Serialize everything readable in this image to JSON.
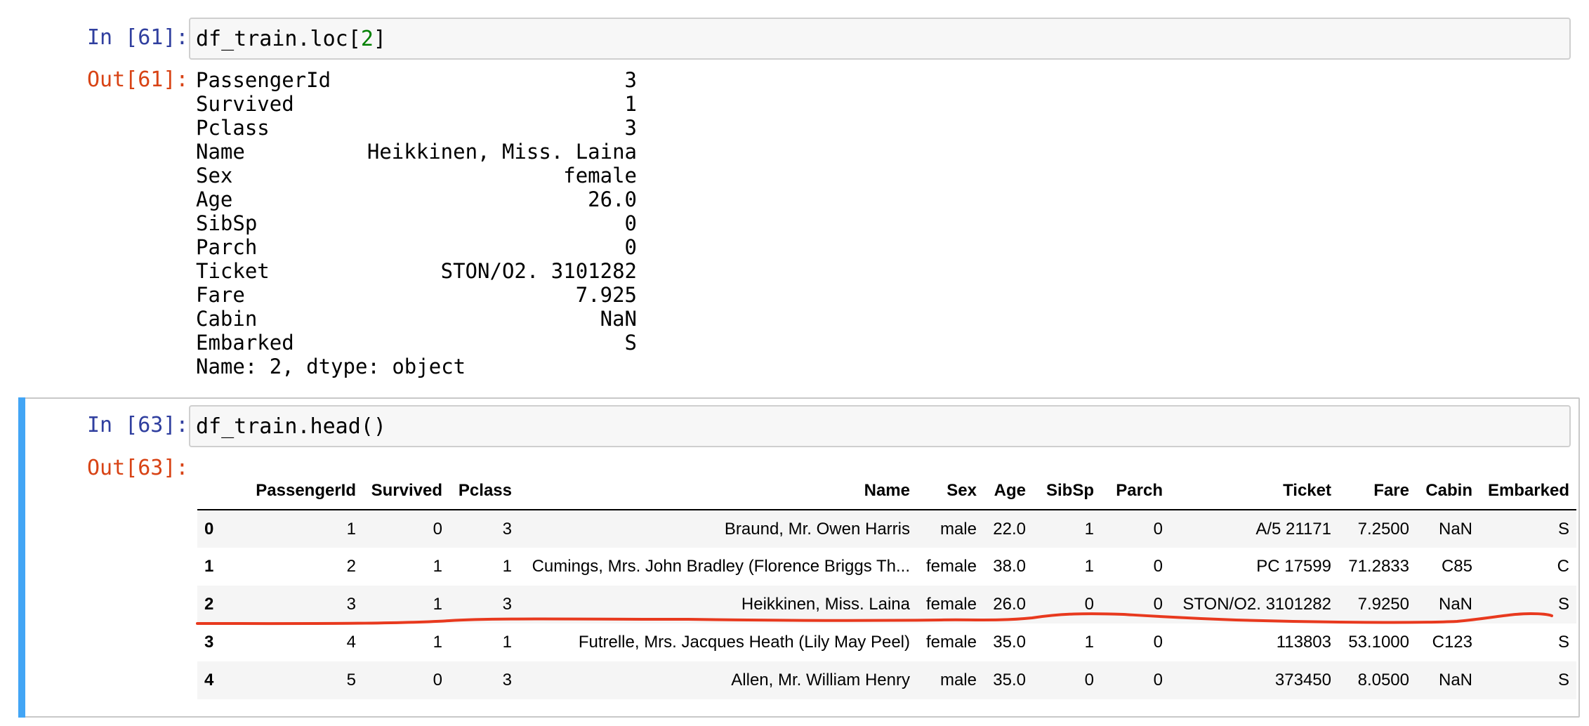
{
  "cell61": {
    "in_prompt": "In [61]:",
    "code_prefix": "df_train.loc[",
    "code_number": "2",
    "code_suffix": "]",
    "out_prompt": "Out[61]:",
    "series": [
      {
        "key": "PassengerId",
        "value": "3"
      },
      {
        "key": "Survived",
        "value": "1"
      },
      {
        "key": "Pclass",
        "value": "3"
      },
      {
        "key": "Name",
        "value": "Heikkinen, Miss. Laina"
      },
      {
        "key": "Sex",
        "value": "female"
      },
      {
        "key": "Age",
        "value": "26.0"
      },
      {
        "key": "SibSp",
        "value": "0"
      },
      {
        "key": "Parch",
        "value": "0"
      },
      {
        "key": "Ticket",
        "value": "STON/O2. 3101282"
      },
      {
        "key": "Fare",
        "value": "7.925"
      },
      {
        "key": "Cabin",
        "value": "NaN"
      },
      {
        "key": "Embarked",
        "value": "S"
      }
    ],
    "footer": "Name: 2, dtype: object"
  },
  "cell63": {
    "in_prompt": "In [63]:",
    "code": "df_train.head()",
    "out_prompt": "Out[63]:",
    "table": {
      "columns": [
        "",
        "PassengerId",
        "Survived",
        "Pclass",
        "Name",
        "Sex",
        "Age",
        "SibSp",
        "Parch",
        "Ticket",
        "Fare",
        "Cabin",
        "Embarked"
      ],
      "rows": [
        [
          "0",
          "1",
          "0",
          "3",
          "Braund, Mr. Owen Harris",
          "male",
          "22.0",
          "1",
          "0",
          "A/5 21171",
          "7.2500",
          "NaN",
          "S"
        ],
        [
          "1",
          "2",
          "1",
          "1",
          "Cumings, Mrs. John Bradley (Florence Briggs Th...",
          "female",
          "38.0",
          "1",
          "0",
          "PC 17599",
          "71.2833",
          "C85",
          "C"
        ],
        [
          "2",
          "3",
          "1",
          "3",
          "Heikkinen, Miss. Laina",
          "female",
          "26.0",
          "0",
          "0",
          "STON/O2. 3101282",
          "7.9250",
          "NaN",
          "S"
        ],
        [
          "3",
          "4",
          "1",
          "1",
          "Futrelle, Mrs. Jacques Heath (Lily May Peel)",
          "female",
          "35.0",
          "1",
          "0",
          "113803",
          "53.1000",
          "C123",
          "S"
        ],
        [
          "4",
          "5",
          "0",
          "3",
          "Allen, Mr. William Henry",
          "male",
          "35.0",
          "0",
          "0",
          "373450",
          "8.0500",
          "NaN",
          "S"
        ]
      ]
    }
  },
  "colors": {
    "in_prompt": "#303F9F",
    "out_prompt": "#D84315",
    "selected_bar": "#42A5F5",
    "annotation_line": "#E8391E"
  }
}
